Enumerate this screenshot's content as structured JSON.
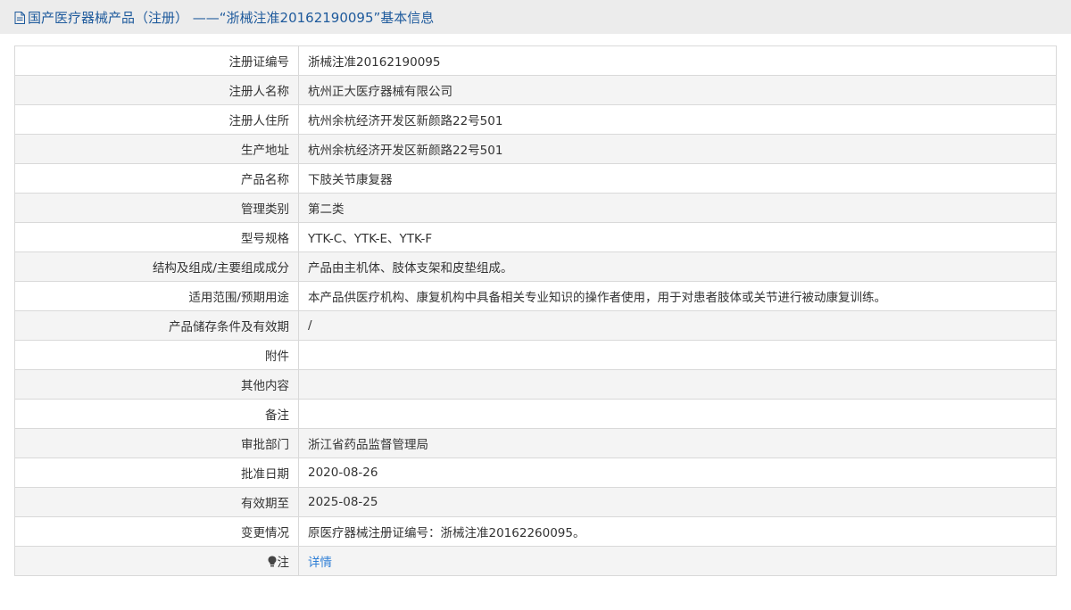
{
  "header": {
    "icon": "document-icon",
    "title": "国产医疗器械产品（注册） ——“浙械注准20162190095”基本信息"
  },
  "rows": [
    {
      "label": "注册证编号",
      "value": "浙械注准20162190095"
    },
    {
      "label": "注册人名称",
      "value": "杭州正大医疗器械有限公司"
    },
    {
      "label": "注册人住所",
      "value": "杭州余杭经济开发区新颜路22号501"
    },
    {
      "label": "生产地址",
      "value": "杭州余杭经济开发区新颜路22号501"
    },
    {
      "label": "产品名称",
      "value": "下肢关节康复器"
    },
    {
      "label": "管理类别",
      "value": "第二类"
    },
    {
      "label": "型号规格",
      "value": "YTK-C、YTK-E、YTK-F"
    },
    {
      "label": "结构及组成/主要组成成分",
      "value": "产品由主机体、肢体支架和皮垫组成。"
    },
    {
      "label": "适用范围/预期用途",
      "value": "本产品供医疗机构、康复机构中具备相关专业知识的操作者使用，用于对患者肢体或关节进行被动康复训练。"
    },
    {
      "label": "产品储存条件及有效期",
      "value": "/"
    },
    {
      "label": "附件",
      "value": ""
    },
    {
      "label": "其他内容",
      "value": ""
    },
    {
      "label": "备注",
      "value": ""
    },
    {
      "label": "审批部门",
      "value": "浙江省药品监督管理局"
    },
    {
      "label": "批准日期",
      "value": "2020-08-26"
    },
    {
      "label": "有效期至",
      "value": "2025-08-25"
    },
    {
      "label": "变更情况",
      "value": "原医疗器械注册证编号：浙械注准20162260095。"
    }
  ],
  "note_row": {
    "icon": "lightbulb-icon",
    "label": "注",
    "link_text": "详情"
  },
  "colors": {
    "title": "#1e5a9c",
    "link": "#2f7fd6",
    "border": "#d9d9d9",
    "stripe": "#f4f4f4"
  }
}
